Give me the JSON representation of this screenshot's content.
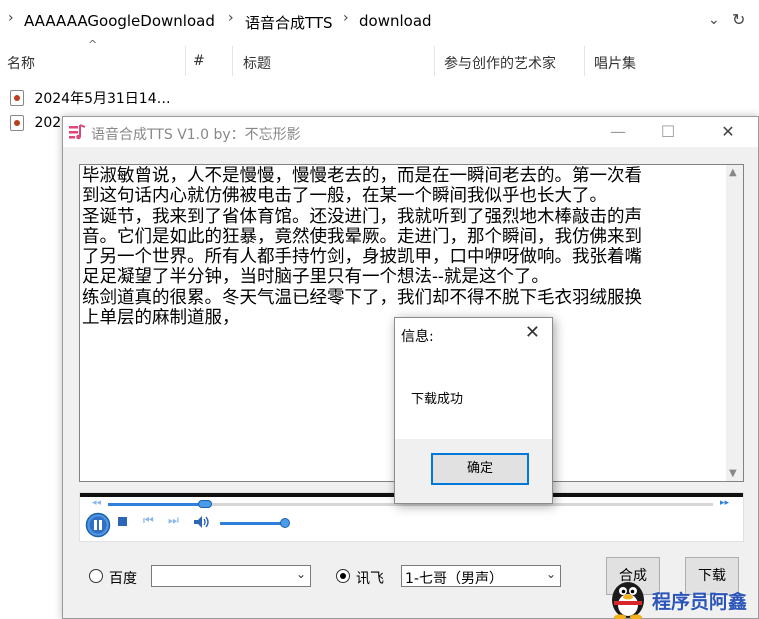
{
  "explorer": {
    "breadcrumb": [
      "AAAAAAGoogleDownload",
      "语音合成TTS",
      "download"
    ],
    "columns": [
      "名称",
      "#",
      "标题",
      "参与创作的艺术家",
      "唱片集"
    ],
    "files": [
      "2024年5月31日14…",
      "202"
    ]
  },
  "tts_window": {
    "title": "语音合成TTS V1.0 by：不忘形影",
    "text_lines": [
      "毕淑敏曾说，人不是慢慢，慢慢老去的，而是在一瞬间老去的。第一次看",
      "到这句话内心就仿佛被电击了一般，在某一个瞬间我似乎也长大了。",
      "圣诞节，我来到了省体育馆。还没进门，我就听到了强烈地木棒敲击的声",
      "音。它们是如此的狂暴，竟然使我晕厥。走进门，那个瞬间，我仿佛来到",
      "了另一个世界。所有人都手持竹剑，身披凯甲，口中咿呀做响。我张着嘴",
      "足足凝望了半分钟，当时脑子里只有一个想法--就是这个了。",
      "练剑道真的很累。冬天气温已经零下了，我们却不得不脱下毛衣羽绒服换",
      "上单层的麻制道服，"
    ],
    "player": {
      "progress": 0.16,
      "volume": 0.95
    },
    "engine_baidu_label": "百度",
    "baidu_voice": "",
    "engine_xunfei_label": "讯飞",
    "xunfei_voice": "1-七哥（男声）",
    "synthesize_button": "合成",
    "download_button": "下载"
  },
  "dialog": {
    "title": "信息:",
    "message": "下载成功",
    "ok_button": "确定"
  },
  "watermark": "程序员阿鑫",
  "colors": {
    "accent": "#2f7fdc",
    "watermark": "#2c55b8",
    "focus": "#0078d7"
  }
}
